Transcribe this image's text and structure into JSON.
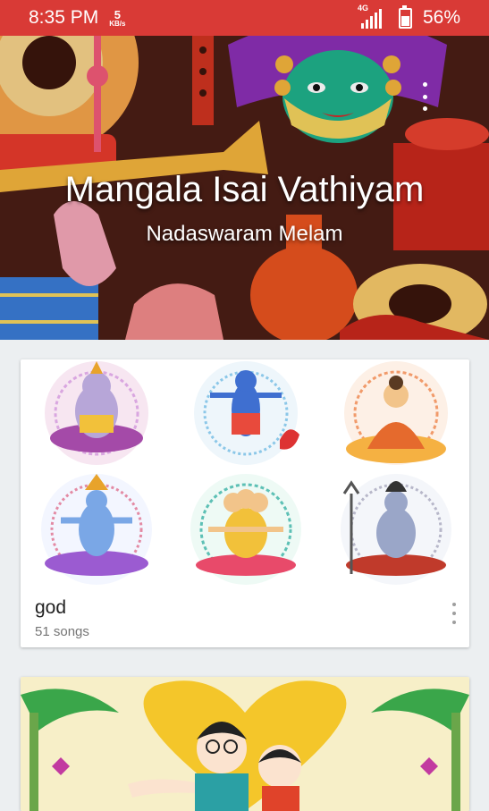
{
  "status_bar": {
    "time": "8:35 PM",
    "net_speed_value": "5",
    "net_speed_unit": "KB/s",
    "network_type": "4G",
    "battery_percent": "56%",
    "battery_level": 0.56,
    "icons": [
      "signal-icon",
      "battery-icon"
    ]
  },
  "header": {
    "title": "Mangala Isai Vathiyam",
    "subtitle": "Nadaswaram Melam",
    "menu_icon": "more-vert-icon"
  },
  "playlists": [
    {
      "title": "god",
      "meta": "51 songs",
      "menu_icon": "more-vert-icon",
      "artwork": [
        "ganesha",
        "kali",
        "buddha",
        "vishnu",
        "brahma",
        "shiva"
      ]
    },
    {
      "title": "",
      "meta": "",
      "artwork": [
        "wedding-couple"
      ]
    }
  ],
  "colors": {
    "status_bar": "#d93a36",
    "background": "#eceff1",
    "card": "#ffffff"
  }
}
